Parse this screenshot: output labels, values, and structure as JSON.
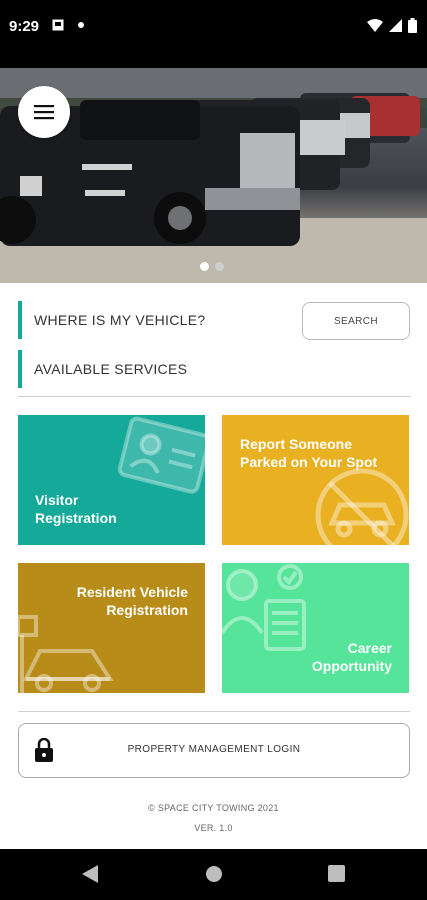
{
  "status_bar": {
    "time": "9:29"
  },
  "hero": {
    "menu_icon": "hamburger-icon",
    "slide_count": 2,
    "active_slide": 1
  },
  "vehicle_search": {
    "title": "WHERE IS MY VEHICLE?",
    "button": "SEARCH"
  },
  "services": {
    "title": "AVAILABLE SERVICES"
  },
  "tiles": [
    {
      "label_line1": "Visitor",
      "label_line2": "Registration",
      "color": "#14a999",
      "icon": "id-card-icon"
    },
    {
      "label_line1": "Report Someone",
      "label_line2": "Parked on Your Spot",
      "color": "#e9b021",
      "icon": "no-parking-car-icon"
    },
    {
      "label_line1": "Resident Vehicle",
      "label_line2": "Registration",
      "color": "#b88c18",
      "icon": "car-parking-icon"
    },
    {
      "label_line1": "Career",
      "label_line2": "Opportunity",
      "color": "#56e39a",
      "icon": "job-applicant-icon"
    }
  ],
  "login": {
    "label": "PROPERTY MANAGEMENT LOGIN",
    "icon": "lock-icon"
  },
  "footer": {
    "copyright": "© SPACE CITY TOWING 2021",
    "version": "VER. 1.0"
  },
  "colors": {
    "accent": "#16a99a"
  }
}
